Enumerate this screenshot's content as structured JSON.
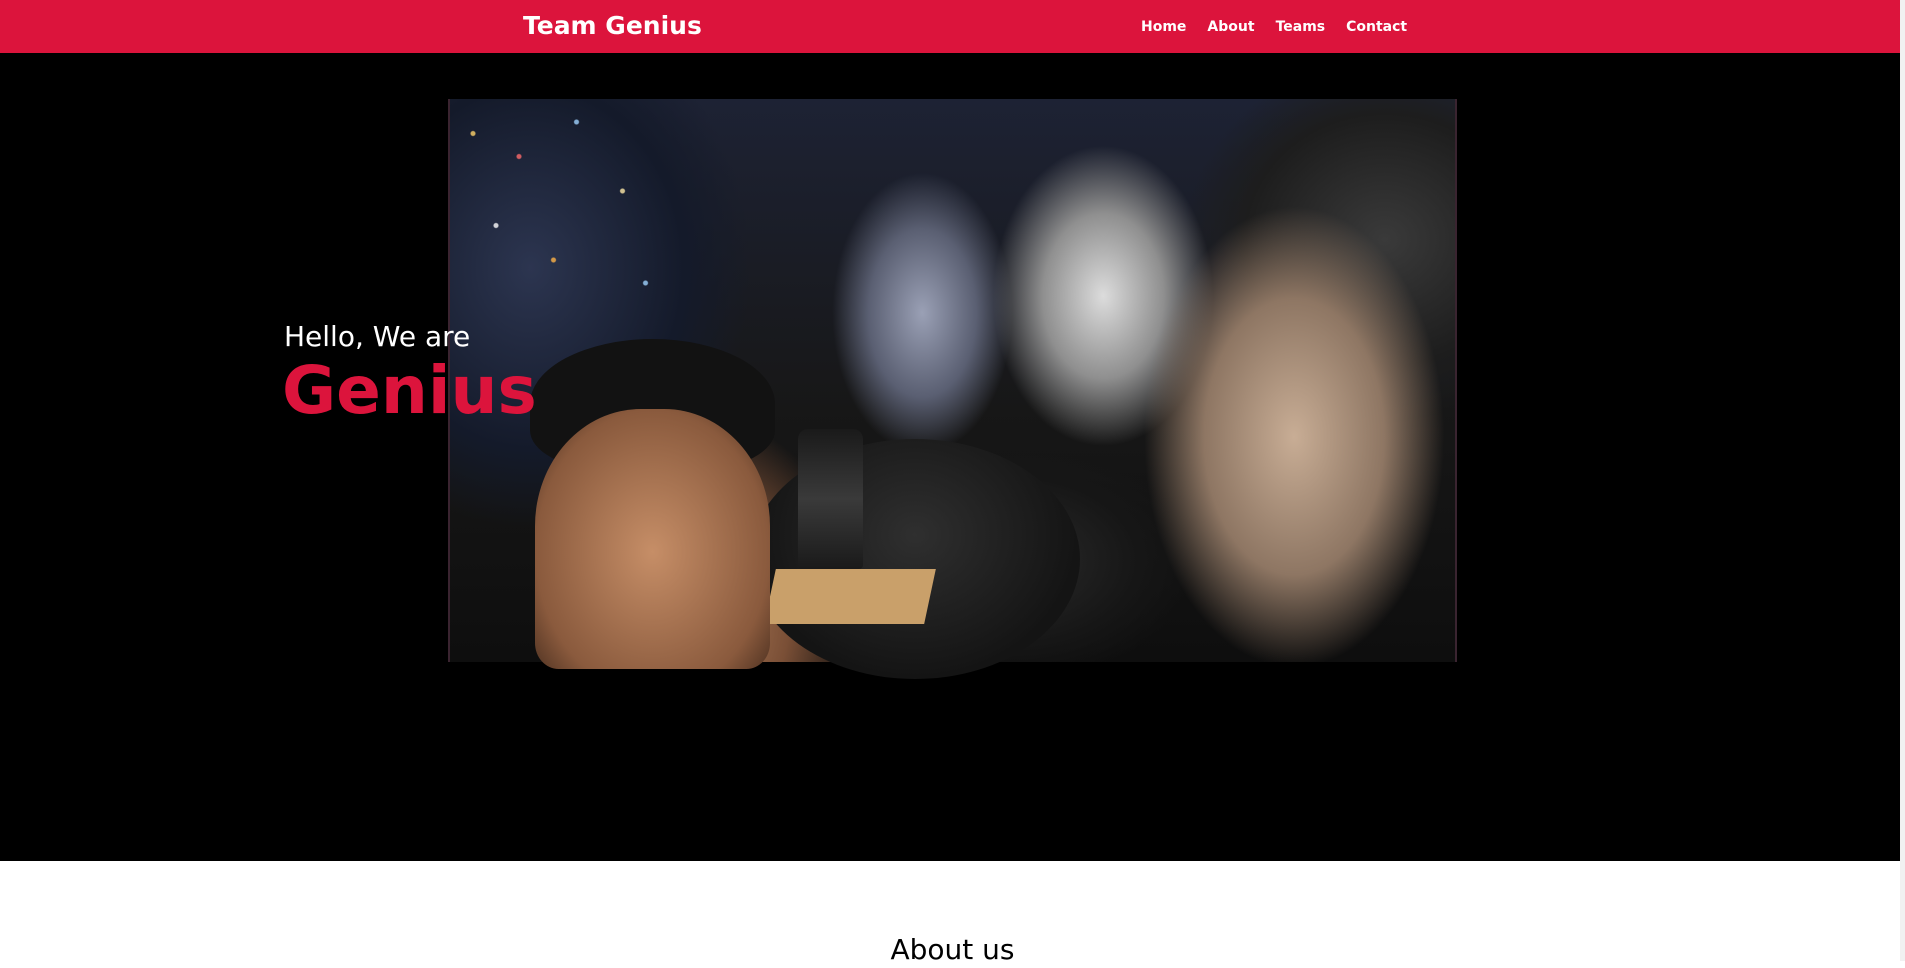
{
  "navbar": {
    "brand": "Team Genius",
    "links": [
      "Home",
      "About",
      "Teams",
      "Contact"
    ],
    "background_color": "#dc143c"
  },
  "hero": {
    "greeting": "Hello, We are",
    "title": "Genius",
    "title_color": "#dc143c",
    "background_color": "#000000",
    "image": "team-group-photo"
  },
  "about": {
    "title": "About us"
  }
}
